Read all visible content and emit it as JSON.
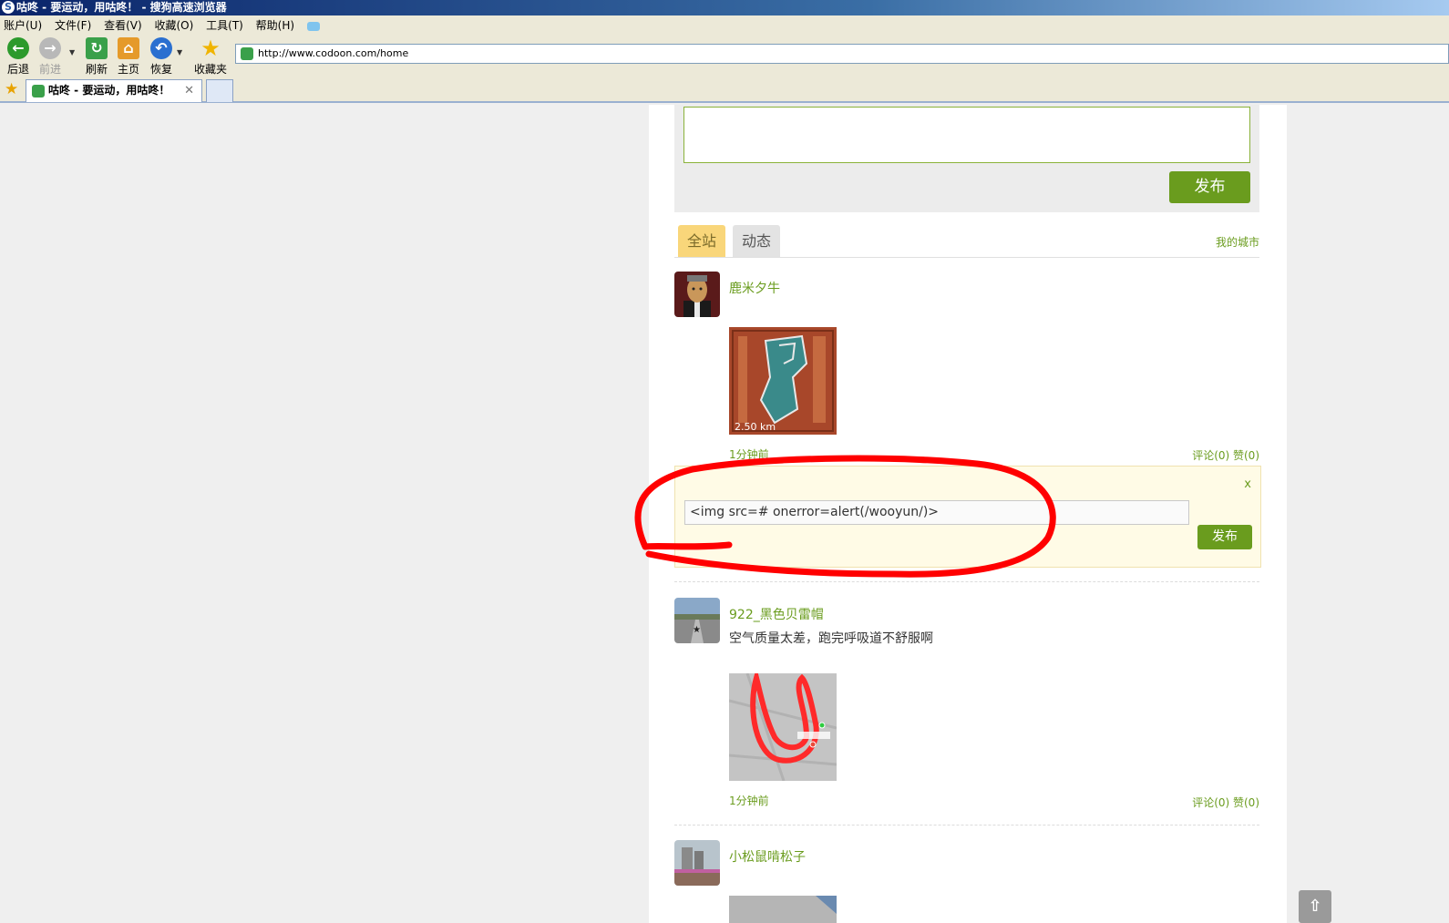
{
  "window": {
    "title": "咕咚 - 要运动，用咕咚！ - 搜狗高速浏览器",
    "app_icon_glyph": "S"
  },
  "menubar": {
    "items": [
      "账户(U)",
      "文件(F)",
      "查看(V)",
      "收藏(O)",
      "工具(T)",
      "帮助(H)"
    ],
    "skin_icon": "shirt-icon"
  },
  "toolbar": {
    "back_label": "后退",
    "forward_label": "前进",
    "refresh_label": "刷新",
    "home_label": "主页",
    "restore_label": "恢复",
    "favorites_label": "收藏夹",
    "address_url": "http://www.codoon.com/home"
  },
  "tabs": {
    "active_title": "咕咚 - 要运动，用咕咚！",
    "close_glyph": "✕"
  },
  "composer": {
    "placeholder": "",
    "publish_label": "发布"
  },
  "feed_tabs": {
    "all_label": "全站",
    "feed_label": "动态",
    "my_city_label": "我的城市"
  },
  "posts": [
    {
      "username": "鹿米夕牛",
      "status": "",
      "image_caption": "2.50 km",
      "time": "1分钟前",
      "actions": "评论(0) 赞(0)"
    },
    {
      "username": "922_黑色贝雷帽",
      "status": "空气质量太差，跑完呼吸道不舒服啊",
      "time": "1分钟前",
      "actions": "评论(0) 赞(0)"
    },
    {
      "username": "小松鼠啃松子",
      "status": ""
    }
  ],
  "comment_box": {
    "close_glyph": "x",
    "input_value": "<img src=# onerror=alert(/wooyun/)>",
    "submit_label": "发布"
  },
  "colors": {
    "accent_green": "#6a9c1e",
    "tab_active_bg": "#f9d67a",
    "annotation_red": "#ff0000"
  }
}
